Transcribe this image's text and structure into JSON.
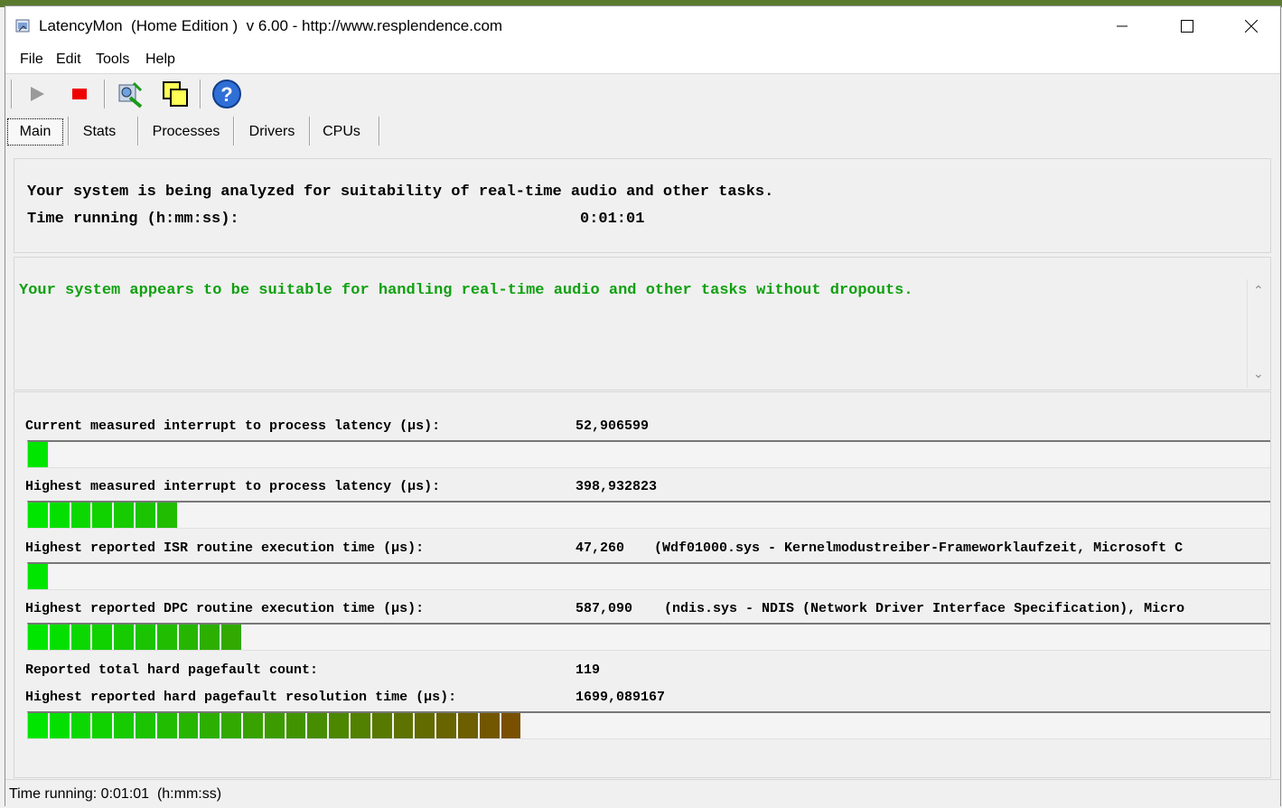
{
  "window": {
    "title": "LatencyMon  (Home Edition )  v 6.00 - http://www.resplendence.com",
    "minimize_icon": "minimize-icon",
    "maximize_icon": "maximize-icon",
    "close_icon": "close-icon"
  },
  "menu": [
    "File",
    "Edit",
    "Tools",
    "Help"
  ],
  "toolbar": {
    "buttons": [
      "play-icon",
      "stop-icon",
      "analyze-icon",
      "windows-icon",
      "help-icon"
    ]
  },
  "tabs": [
    "Main",
    "Stats",
    "Processes",
    "Drivers",
    "CPUs"
  ],
  "active_tab": "Main",
  "summary": {
    "line1": "Your system is being analyzed for suitability of real-time audio and other tasks.",
    "time_label": "Time running (h:mm:ss):",
    "time_value": "0:01:01"
  },
  "verdict": {
    "text": "Your system appears to be suitable for handling real-time audio and other tasks without dropouts.",
    "color": "#10a010"
  },
  "metrics": [
    {
      "label": "Current measured interrupt to process latency (µs):",
      "value": "52,906599",
      "detail": "",
      "segments": 1
    },
    {
      "label": "Highest measured interrupt to process latency (µs):",
      "value": "398,932823",
      "detail": "",
      "segments": 7
    },
    {
      "label": "Highest reported ISR routine execution time (µs):",
      "value": "47,260",
      "detail": "(Wdf01000.sys - Kernelmodustreiber-Frameworklaufzeit, Microsoft C",
      "segments": 1
    },
    {
      "label": "Highest reported DPC routine execution time (µs):",
      "value": "587,090",
      "detail": "(ndis.sys - NDIS (Network Driver Interface Specification), Micro",
      "segments": 10
    }
  ],
  "pagefault": {
    "count_label": "Reported total hard pagefault count:",
    "count_value": "119",
    "time_label": "Highest reported hard pagefault resolution time (µs):",
    "time_value": "1699,089167",
    "segments": 23
  },
  "status_bar": "Time running: 0:01:01  (h:mm:ss)"
}
